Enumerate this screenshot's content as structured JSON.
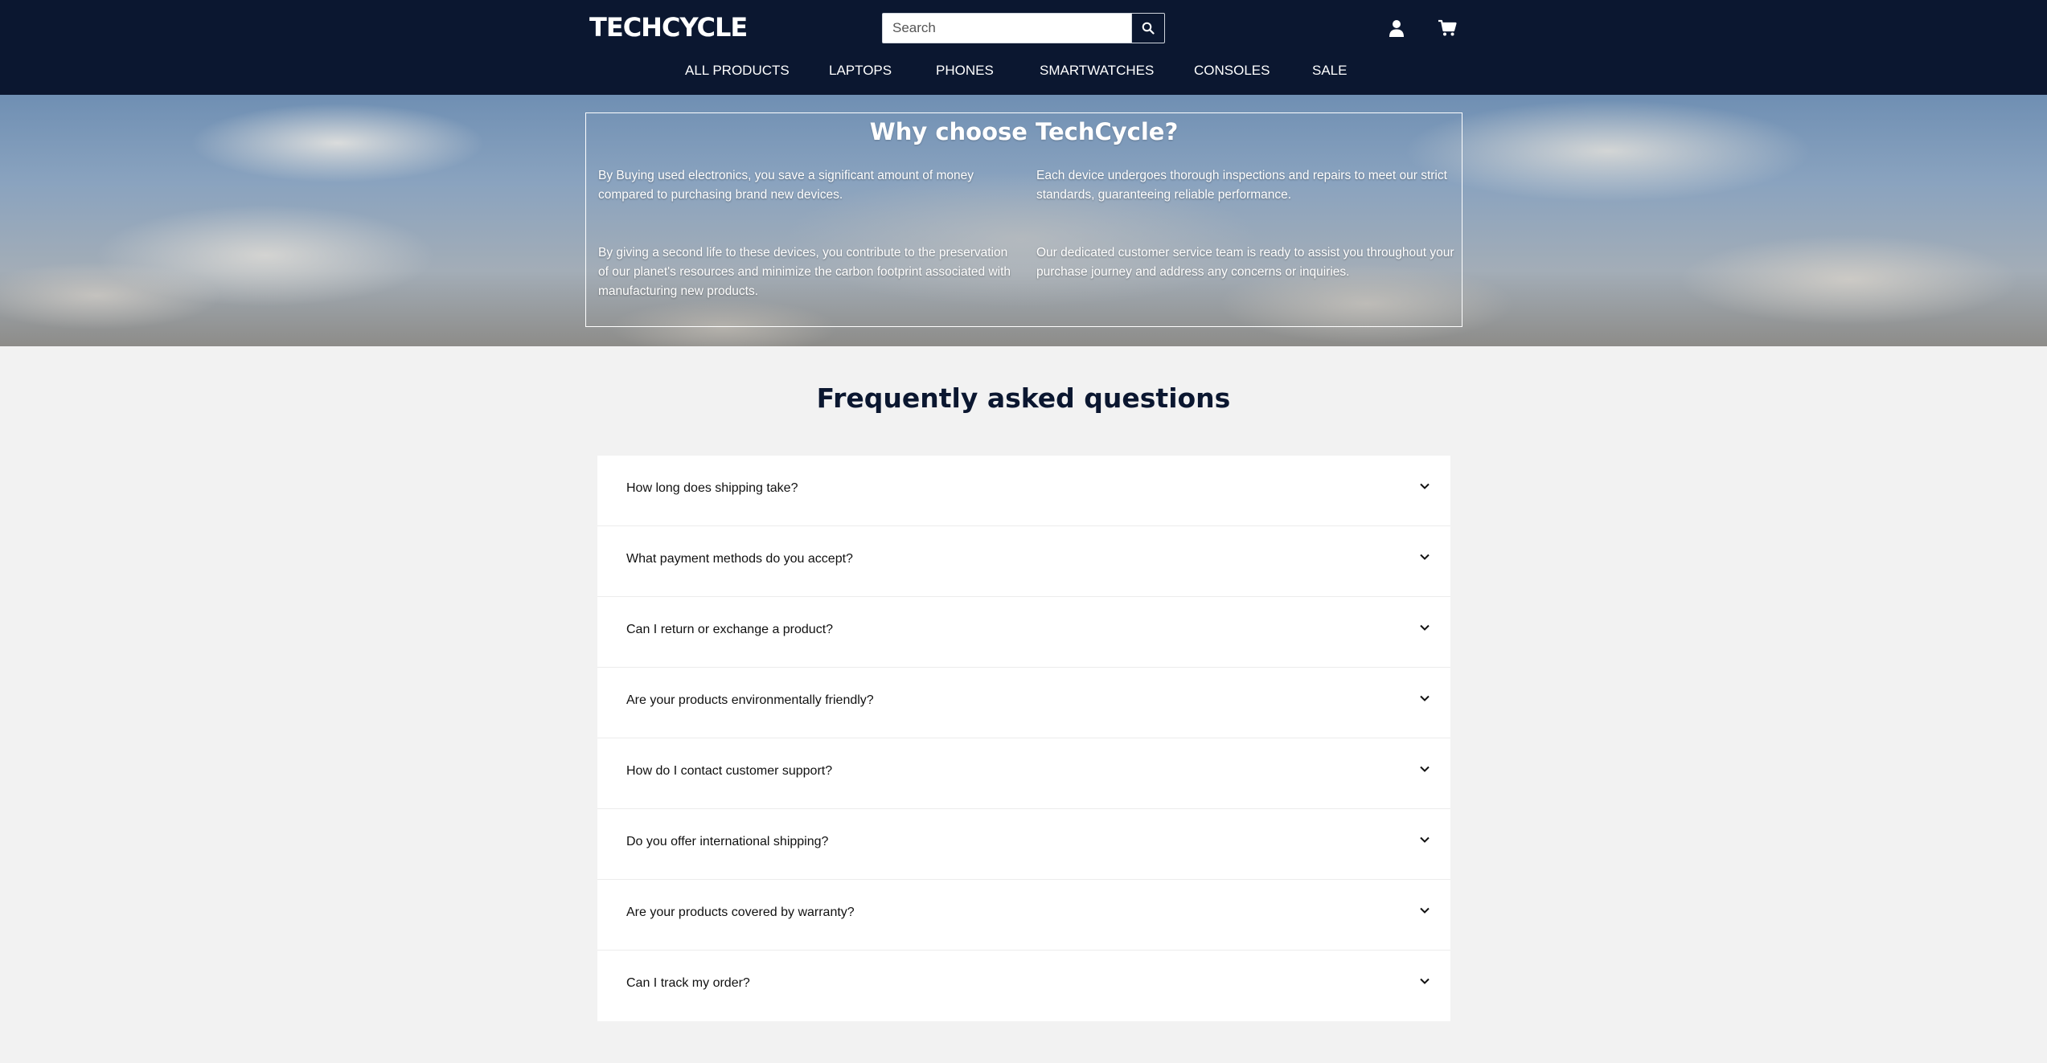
{
  "header": {
    "logo": "TECHCYCLE",
    "search": {
      "placeholder": "Search",
      "value": ""
    },
    "icons": [
      "search-icon",
      "user-icon",
      "cart-icon"
    ],
    "background_color": "#0b1730"
  },
  "nav": {
    "items": [
      {
        "label": "ALL PRODUCTS"
      },
      {
        "label": "LAPTOPS"
      },
      {
        "label": "PHONES"
      },
      {
        "label": "SMARTWATCHES"
      },
      {
        "label": "CONSOLES"
      },
      {
        "label": "SALE"
      }
    ]
  },
  "why": {
    "title": "Why choose TechCycle?",
    "points": [
      "By Buying used electronics, you save a significant amount of money compared to purchasing brand new devices.",
      "Each device undergoes thorough inspections and repairs to meet our strict standards, guaranteeing reliable performance.",
      "By giving a second life to these devices, you contribute to the preservation of our planet's resources and minimize the carbon footprint associated with manufacturing new products.",
      "Our dedicated customer service team is ready to assist you throughout your purchase journey and address any concerns or inquiries."
    ]
  },
  "faq": {
    "title": "Frequently asked questions",
    "items": [
      {
        "question": "How long does shipping take?"
      },
      {
        "question": "What payment methods do you accept?"
      },
      {
        "question": "Can I return or exchange a product?"
      },
      {
        "question": "Are your products environmentally friendly?"
      },
      {
        "question": "How do I contact customer support?"
      },
      {
        "question": "Do you offer international shipping?"
      },
      {
        "question": "Are your products covered by warranty?"
      },
      {
        "question": "Can I track my order?"
      }
    ]
  }
}
